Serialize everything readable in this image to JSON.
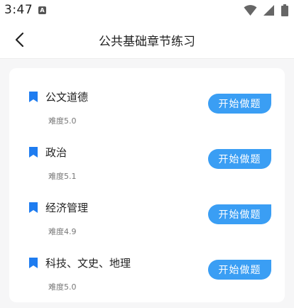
{
  "status_bar": {
    "time": "3:47",
    "indicator": "A",
    "icons": [
      "wifi-icon",
      "signal-icon",
      "battery-icon"
    ]
  },
  "header": {
    "back_icon": "chevron-left-icon",
    "title": "公共基础章节练习"
  },
  "chapters": [
    {
      "name": "公文道德",
      "difficulty": "难度5.0",
      "button": "开始做题"
    },
    {
      "name": "政治",
      "difficulty": "难度5.1",
      "button": "开始做题"
    },
    {
      "name": "经济管理",
      "difficulty": "难度4.9",
      "button": "开始做题"
    },
    {
      "name": "科技、文史、地理",
      "difficulty": "难度5.0",
      "button": "开始做题"
    }
  ],
  "colors": {
    "accent": "#3a9ef4",
    "bookmark": "#1e7cf0",
    "background": "#f6f6f7",
    "card": "#ffffff"
  }
}
